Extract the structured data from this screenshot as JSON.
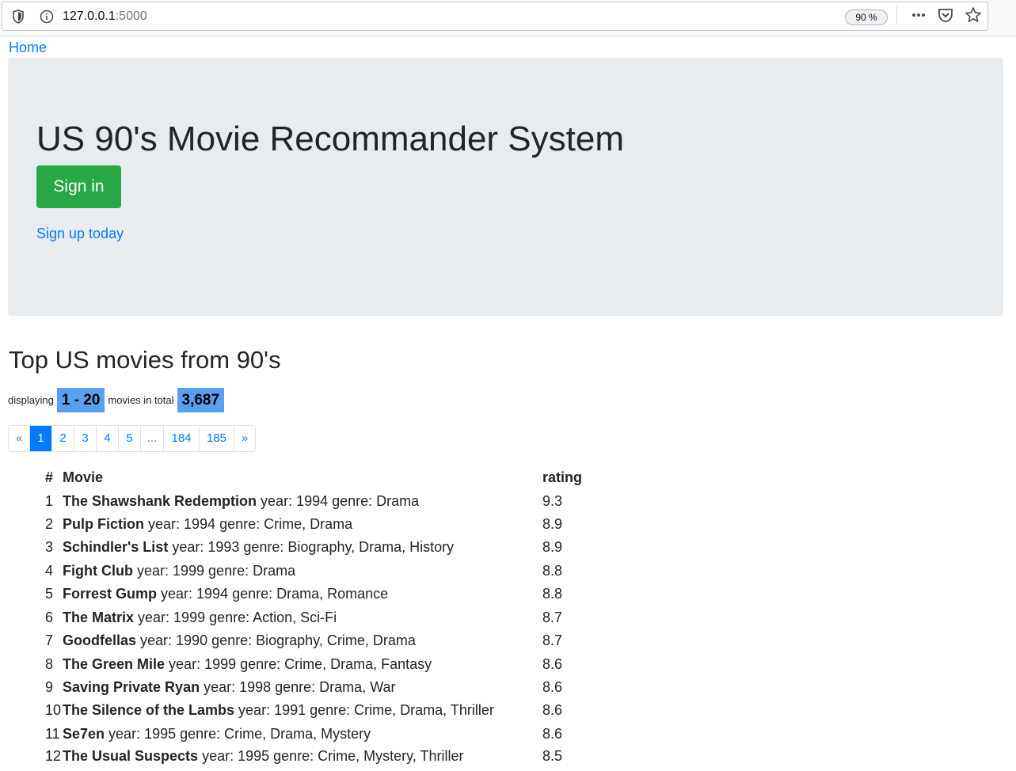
{
  "browser": {
    "url_host": "127.0.0.1",
    "url_port": ":5000",
    "zoom": "90 %"
  },
  "nav": {
    "home": "Home"
  },
  "jumbotron": {
    "title": "US 90's Movie Recommander System",
    "signin": "Sign in",
    "signup": "Sign up today"
  },
  "section": {
    "title": "Top US movies from 90's"
  },
  "display": {
    "prefix": "displaying",
    "range": "1 - 20",
    "middle": "movies in total",
    "total": "3,687"
  },
  "pagination": [
    "«",
    "1",
    "2",
    "3",
    "4",
    "5",
    "...",
    "184",
    "185",
    "»"
  ],
  "table": {
    "headers": {
      "num": "#",
      "movie": "Movie",
      "rating": "rating"
    },
    "rows": [
      {
        "num": "1",
        "title": "The Shawshank Redemption",
        "detail": " year: 1994 genre: Drama",
        "rating": "9.3"
      },
      {
        "num": "2",
        "title": "Pulp Fiction",
        "detail": " year: 1994 genre: Crime, Drama",
        "rating": "8.9"
      },
      {
        "num": "3",
        "title": "Schindler's List",
        "detail": " year: 1993 genre: Biography, Drama, History",
        "rating": "8.9"
      },
      {
        "num": "4",
        "title": "Fight Club",
        "detail": " year: 1999 genre: Drama",
        "rating": "8.8"
      },
      {
        "num": "5",
        "title": "Forrest Gump",
        "detail": " year: 1994 genre: Drama, Romance",
        "rating": "8.8"
      },
      {
        "num": "6",
        "title": "The Matrix",
        "detail": " year: 1999 genre: Action, Sci-Fi",
        "rating": "8.7"
      },
      {
        "num": "7",
        "title": "Goodfellas",
        "detail": " year: 1990 genre: Biography, Crime, Drama",
        "rating": "8.7"
      },
      {
        "num": "8",
        "title": "The Green Mile",
        "detail": " year: 1999 genre: Crime, Drama, Fantasy",
        "rating": "8.6"
      },
      {
        "num": "9",
        "title": "Saving Private Ryan",
        "detail": " year: 1998 genre: Drama, War",
        "rating": "8.6"
      },
      {
        "num": "10",
        "title": "The Silence of the Lambs",
        "detail": " year: 1991 genre: Crime, Drama, Thriller",
        "rating": "8.6"
      },
      {
        "num": "11",
        "title": "Se7en",
        "detail": " year: 1995 genre: Crime, Drama, Mystery",
        "rating": "8.6"
      },
      {
        "num": "12",
        "title": "The Usual Suspects",
        "detail": " year: 1995 genre: Crime, Mystery, Thriller",
        "rating": "8.5"
      }
    ]
  },
  "colors": {
    "primary": "#007bff",
    "success": "#28a745",
    "jumbotron_bg": "#e9ecef",
    "highlight": "#5aa0f0"
  }
}
